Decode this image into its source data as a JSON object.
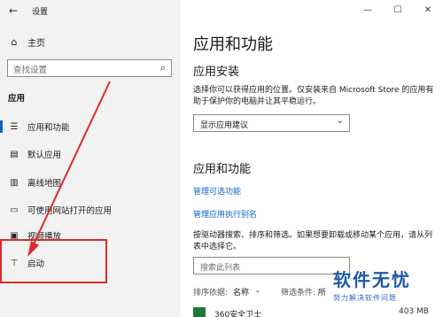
{
  "window": {
    "title": "设置",
    "back_glyph": "←",
    "controls": {
      "minimize": "—",
      "maximize": "☐",
      "close": "✕"
    }
  },
  "sidebar": {
    "home": {
      "label": "主页",
      "icon": "home-icon"
    },
    "search": {
      "placeholder": "查找设置",
      "icon": "search-icon"
    },
    "section_label": "应用",
    "items": [
      {
        "label": "应用和功能",
        "icon": "apps-list-icon",
        "selected": true
      },
      {
        "label": "默认应用",
        "icon": "default-apps-icon",
        "selected": false
      },
      {
        "label": "离线地图",
        "icon": "map-icon",
        "selected": false
      },
      {
        "label": "可使用网站打开的应用",
        "icon": "website-apps-icon",
        "selected": false
      },
      {
        "label": "视频播放",
        "icon": "video-icon",
        "selected": false
      },
      {
        "label": "启动",
        "icon": "startup-icon",
        "selected": false
      }
    ]
  },
  "main": {
    "title": "应用和功能",
    "install_heading": "应用安装",
    "install_desc": "选择你可以获得应用的位置。仅安装来自 Microsoft Store 的应用有助于保护你的电脑并让其平稳运行。",
    "dropdown_value": "显示应用建议",
    "features_heading": "应用和功能",
    "links": [
      "管理可选功能",
      "管理应用执行别名"
    ],
    "list_desc": "按驱动器搜索、排序和筛选。如果想要卸载或移动某个应用，请从列表中选择它。",
    "list_search_placeholder": "搜索此列表",
    "sort_label": "排序依据:",
    "sort_value": "名称",
    "filter_label": "筛选条件:",
    "filter_value": "所",
    "first_app": {
      "name": "360安全卫士",
      "size": "403 MB"
    }
  },
  "watermark": {
    "line1": "软件无忧",
    "line2": "努力解决软件问题"
  },
  "colors": {
    "accent": "#0a63c9",
    "annotation": "#e02a2a",
    "sidebar_bg": "#f2f2f2"
  }
}
